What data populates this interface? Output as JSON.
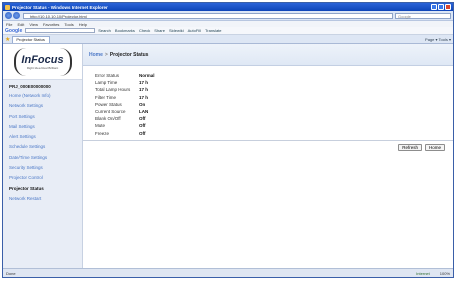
{
  "window": {
    "title": "Projector Status - Windows Internet Explorer"
  },
  "address": {
    "url": "http://10.10.10.10/Projector.html",
    "search_placeholder": "Google"
  },
  "menu": [
    "File",
    "Edit",
    "View",
    "Favorites",
    "Tools",
    "Help"
  ],
  "google_toolbar": {
    "logo": "Google",
    "items": [
      "Search",
      "Bookmarks",
      "Check",
      "Share",
      "Sidewiki",
      "AutoFill",
      "Translate"
    ]
  },
  "tab": {
    "label": "Projector Status",
    "tools": "Page ▾  Tools ▾"
  },
  "brand": {
    "name": "InFocus",
    "tagline": "Right Idea Real Brilliant"
  },
  "device_id": "PRJ_000E00000000",
  "nav": [
    "Home (Network Info)",
    "Network Settings",
    "Port Settings",
    "Mail Settings",
    "Alert Settings",
    "Schedule Settings",
    "Date/Time Settings",
    "Security Settings",
    "Projector Control",
    "Projector Status",
    "Network Restart"
  ],
  "breadcrumb": {
    "home": "Home",
    "separator": ">",
    "current": "Projector Status"
  },
  "status": [
    {
      "label": "Error Status",
      "value": "Normal"
    },
    {
      "label": "Lamp Time",
      "value": "17 h"
    },
    {
      "label": "Total Lamp Hours",
      "value": "17 h"
    },
    {
      "label": "Filter Time",
      "value": "17 h"
    },
    {
      "label": "Power Status",
      "value": "On"
    },
    {
      "label": "Current Source",
      "value": "LAN"
    },
    {
      "label": "Blank On/Off",
      "value": "Off"
    },
    {
      "label": "Mute",
      "value": "Off"
    },
    {
      "label": "Freeze",
      "value": "Off"
    }
  ],
  "buttons": {
    "refresh": "Refresh",
    "home": "Home"
  },
  "statusbar": {
    "left": "Done",
    "zone": "Internet",
    "zoom": "100%"
  }
}
